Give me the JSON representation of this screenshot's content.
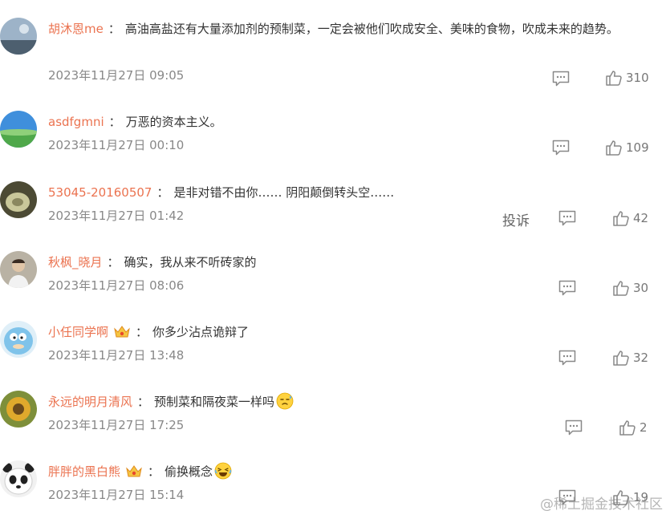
{
  "comments": [
    {
      "user": "胡沐恩me",
      "text": "高油高盐还有大量添加剂的预制菜，一定会被他们吹成安全、美味的食物，吹成未来的趋势。",
      "time": "2023年11月27日 09:05",
      "likes": "310",
      "avatar_color": "#6f8aa6"
    },
    {
      "user": "asdfgmni",
      "text": "万恶的资本主义。",
      "time": "2023年11月27日 00:10",
      "likes": "109",
      "avatar_color": "#4a90d9"
    },
    {
      "user": "53045-20160507",
      "text": "是非对错不由你…… 阴阳颠倒转头空……",
      "time": "2023年11月27日 01:42",
      "likes": "42",
      "report": "投诉",
      "avatar_color": "#6b6a4a"
    },
    {
      "user": "秋枫_晓月",
      "text": "确实，我从来不听砖家的",
      "time": "2023年11月27日 08:06",
      "likes": "30",
      "avatar_color": "#9a8f80"
    },
    {
      "user": "小任同学啊",
      "text": "你多少沾点诡辩了",
      "time": "2023年11月27日 13:48",
      "likes": "32",
      "badge": "crown-badge-icon",
      "avatar_color": "#6fb6e0"
    },
    {
      "user": "永远的明月清风",
      "text": "预制菜和隔夜菜一样吗",
      "time": "2023年11月27日 17:25",
      "likes": "2",
      "emoji": "sweat-smile-emoji-icon",
      "avatar_color": "#c8a23a"
    },
    {
      "user": "胖胖的黑白熊",
      "text": "偷换概念",
      "time": "2023年11月27日 15:14",
      "likes": "19",
      "badge": "crown-badge-icon",
      "emoji": "laughing-tears-emoji-icon",
      "avatar_color": "#333333"
    }
  ],
  "watermark": "@稀土掘金技术社区",
  "colors": {
    "username": "#eb7350",
    "time": "#888888",
    "icon": "#888888"
  }
}
